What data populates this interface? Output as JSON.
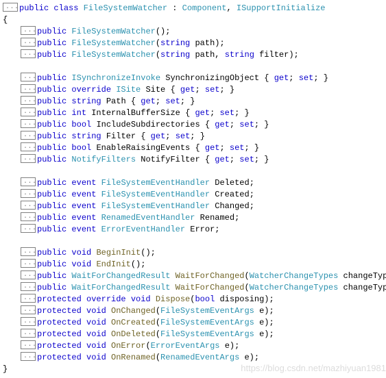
{
  "kw": {
    "public": "public",
    "class": "class",
    "override": "override",
    "string": "string",
    "int": "int",
    "bool": "bool",
    "event": "event",
    "void": "void",
    "protected": "protected",
    "get": "get",
    "set": "set"
  },
  "types": {
    "FileSystemWatcher": "FileSystemWatcher",
    "Component": "Component",
    "ISupportInitialize": "ISupportInitialize",
    "ISynchronizeInvoke": "ISynchronizeInvoke",
    "ISite": "ISite",
    "NotifyFilters": "NotifyFilters",
    "FileSystemEventHandler": "FileSystemEventHandler",
    "RenamedEventHandler": "RenamedEventHandler",
    "ErrorEventHandler": "ErrorEventHandler",
    "WaitForChangedResult": "WaitForChangedResult",
    "WatcherChangeTypes": "WatcherChangeTypes",
    "FileSystemEventArgs": "FileSystemEventArgs",
    "RenamedEventArgs": "RenamedEventArgs",
    "ErrorEventArgs": "ErrorEventArgs"
  },
  "ctor": {
    "p_path": "path",
    "p_filter": "filter"
  },
  "props": {
    "SynchronizingObject": "SynchronizingObject",
    "Site": "Site",
    "Path": "Path",
    "InternalBufferSize": "InternalBufferSize",
    "IncludeSubdirectories": "IncludeSubdirectories",
    "Filter": "Filter",
    "EnableRaisingEvents": "EnableRaisingEvents",
    "NotifyFilter": "NotifyFilter"
  },
  "events": {
    "Deleted": "Deleted",
    "Created": "Created",
    "Changed": "Changed",
    "Renamed": "Renamed",
    "Error": "Error"
  },
  "methods": {
    "BeginInit": "BeginInit",
    "EndInit": "EndInit",
    "WaitForChanged": "WaitForChanged",
    "Dispose": "Dispose",
    "OnChanged": "OnChanged",
    "OnCreated": "OnCreated",
    "OnDeleted": "OnDeleted",
    "OnError": "OnError",
    "OnRenamed": "OnRenamed"
  },
  "params": {
    "changeType": "changeType",
    "disposing": "disposing",
    "e": "e"
  },
  "watermark": "https://blog.csdn.net/mazhiyuan1981"
}
